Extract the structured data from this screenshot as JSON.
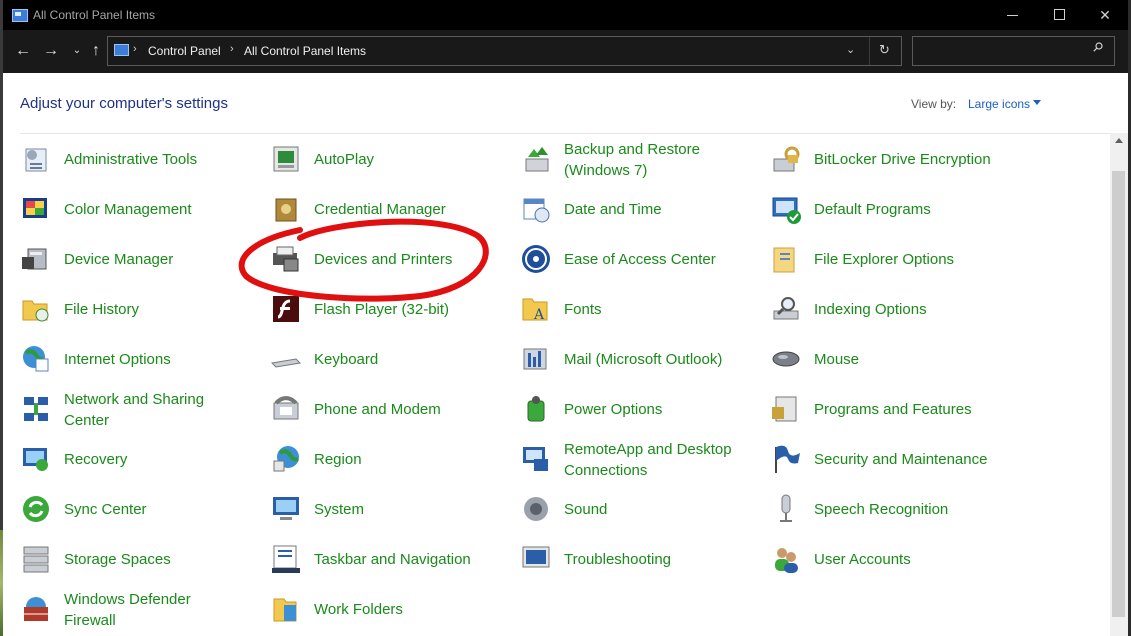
{
  "window": {
    "title": "All Control Panel Items"
  },
  "nav": {
    "breadcrumbs": [
      "Control Panel",
      "All Control Panel Items"
    ],
    "search_placeholder": ""
  },
  "header": {
    "heading": "Adjust your computer's settings",
    "view_by_label": "View by:",
    "view_by_value": "Large icons"
  },
  "colors": {
    "item_text": "#1a8a1a",
    "heading": "#1e3287",
    "link": "#1c5ec4",
    "annotation": "#e01010"
  },
  "items": [
    {
      "label": "Administrative Tools",
      "icon": "administrative-tools-icon"
    },
    {
      "label": "AutoPlay",
      "icon": "autoplay-icon"
    },
    {
      "label": "Backup and Restore",
      "label2": "(Windows 7)",
      "icon": "backup-restore-icon"
    },
    {
      "label": "BitLocker Drive Encryption",
      "icon": "bitlocker-icon"
    },
    {
      "label": "Color Management",
      "icon": "color-management-icon"
    },
    {
      "label": "Credential Manager",
      "icon": "credential-manager-icon"
    },
    {
      "label": "Date and Time",
      "icon": "calendar-clock-icon"
    },
    {
      "label": "Default Programs",
      "icon": "default-programs-icon"
    },
    {
      "label": "Device Manager",
      "icon": "device-manager-icon"
    },
    {
      "label": "Devices and Printers",
      "icon": "printer-icon"
    },
    {
      "label": "Ease of Access Center",
      "icon": "ease-of-access-icon"
    },
    {
      "label": "File Explorer Options",
      "icon": "folder-options-icon"
    },
    {
      "label": "File History",
      "icon": "file-history-icon"
    },
    {
      "label": "Flash Player (32-bit)",
      "icon": "flash-player-icon"
    },
    {
      "label": "Fonts",
      "icon": "fonts-folder-icon"
    },
    {
      "label": "Indexing Options",
      "icon": "indexing-icon"
    },
    {
      "label": "Internet Options",
      "icon": "globe-icon"
    },
    {
      "label": "Keyboard",
      "icon": "keyboard-icon"
    },
    {
      "label": "Mail (Microsoft Outlook)",
      "icon": "mail-icon"
    },
    {
      "label": "Mouse",
      "icon": "mouse-icon"
    },
    {
      "label": "Network and Sharing",
      "label2": "Center",
      "icon": "network-icon"
    },
    {
      "label": "Phone and Modem",
      "icon": "phone-icon"
    },
    {
      "label": "Power Options",
      "icon": "power-icon"
    },
    {
      "label": "Programs and Features",
      "icon": "programs-features-icon"
    },
    {
      "label": "Recovery",
      "icon": "recovery-icon"
    },
    {
      "label": "Region",
      "icon": "region-globe-icon"
    },
    {
      "label": "RemoteApp and Desktop",
      "label2": "Connections",
      "icon": "remoteapp-icon"
    },
    {
      "label": "Security and Maintenance",
      "icon": "flag-icon"
    },
    {
      "label": "Sync Center",
      "icon": "sync-icon"
    },
    {
      "label": "System",
      "icon": "computer-icon"
    },
    {
      "label": "Sound",
      "icon": "speaker-icon"
    },
    {
      "label": "Speech Recognition",
      "icon": "microphone-icon"
    },
    {
      "label": "Storage Spaces",
      "icon": "storage-icon"
    },
    {
      "label": "Taskbar and Navigation",
      "icon": "taskbar-icon"
    },
    {
      "label": "Troubleshooting",
      "icon": "troubleshooting-icon"
    },
    {
      "label": "User Accounts",
      "icon": "users-icon"
    },
    {
      "label": "Windows Defender",
      "label2": "Firewall",
      "icon": "firewall-icon"
    },
    {
      "label": "Work Folders",
      "icon": "work-folders-icon"
    }
  ]
}
